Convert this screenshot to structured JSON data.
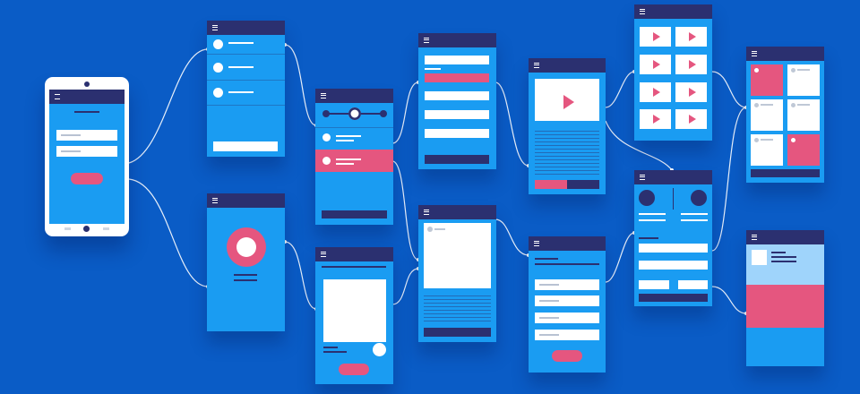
{
  "diagram": {
    "type": "ui-flow-wireframe",
    "colors": {
      "background": "#0a5cc6",
      "screen": "#1a9cf2",
      "header": "#2b3070",
      "accent": "#e5567f",
      "content": "#ffffff",
      "light": "#9fd4fb"
    },
    "icons": [
      "hamburger-menu-icon",
      "play-icon",
      "checkmark-icon",
      "camera-icon",
      "home-button-icon"
    ],
    "screens": [
      "phone-login",
      "checklist",
      "profile",
      "slider-list",
      "card-detail",
      "form",
      "image-detail",
      "video-player",
      "signup-form",
      "video-grid",
      "profile-compare",
      "tile-grid",
      "banner-detail"
    ]
  }
}
